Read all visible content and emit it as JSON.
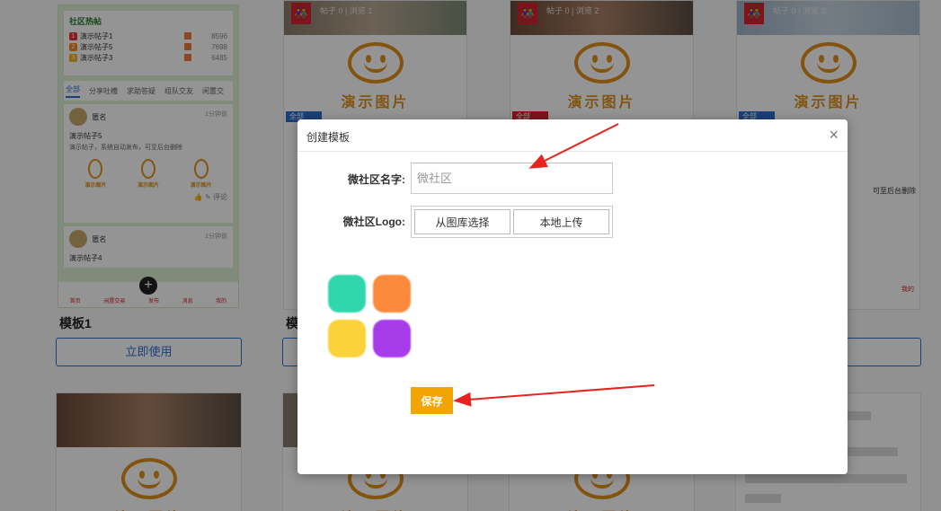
{
  "background": {
    "preview_hot_title": "社区热帖",
    "preview_hot_items": [
      {
        "rank": "1",
        "title": "演示帖子1",
        "count": "8596"
      },
      {
        "rank": "2",
        "title": "演示帖子5",
        "count": "7698"
      },
      {
        "rank": "3",
        "title": "演示帖子3",
        "count": "6485"
      }
    ],
    "preview_tabs": [
      "全部",
      "分享吐槽",
      "求助答疑",
      "组队交友",
      "闲置交"
    ],
    "preview_post1": {
      "author": "匿名",
      "time": "1分钟前",
      "title": "演示帖子5",
      "desc": "演示帖子，系统自动发布，可至后台删除",
      "comment": "评论"
    },
    "preview_post2": {
      "author": "匿名",
      "time": "1分钟前",
      "title": "演示帖子4"
    },
    "preview_nav": [
      "首页",
      "闲置交易",
      "发布",
      "消息",
      "我的"
    ],
    "placeholder_text": "演示图片",
    "thumb_meta_1": "帖子 0 | 浏览 1",
    "thumb_meta_2": "帖子 0 | 浏览 2",
    "thumb_meta_3": "帖子 0 | 浏览 3",
    "badge_all": "全部",
    "template1_label": "模板1",
    "template2_label_partial": "模",
    "use_button": "立即使用",
    "right_partial_text": "可至后台删除",
    "right_partial_nav": "我的"
  },
  "modal": {
    "title": "创建模板",
    "close_glyph": "×",
    "name_label": "微社区名字:",
    "name_placeholder": "微社区",
    "name_value": "",
    "logo_label": "微社区Logo:",
    "logo_from_library": "从图库选择",
    "logo_local_upload": "本地上传",
    "logo_colors": [
      "#30d7ad",
      "#fb8a3c",
      "#fbd23a",
      "#a63bea"
    ],
    "save_button": "保存"
  },
  "annotations": {
    "arrow_color": "#e8231f"
  }
}
